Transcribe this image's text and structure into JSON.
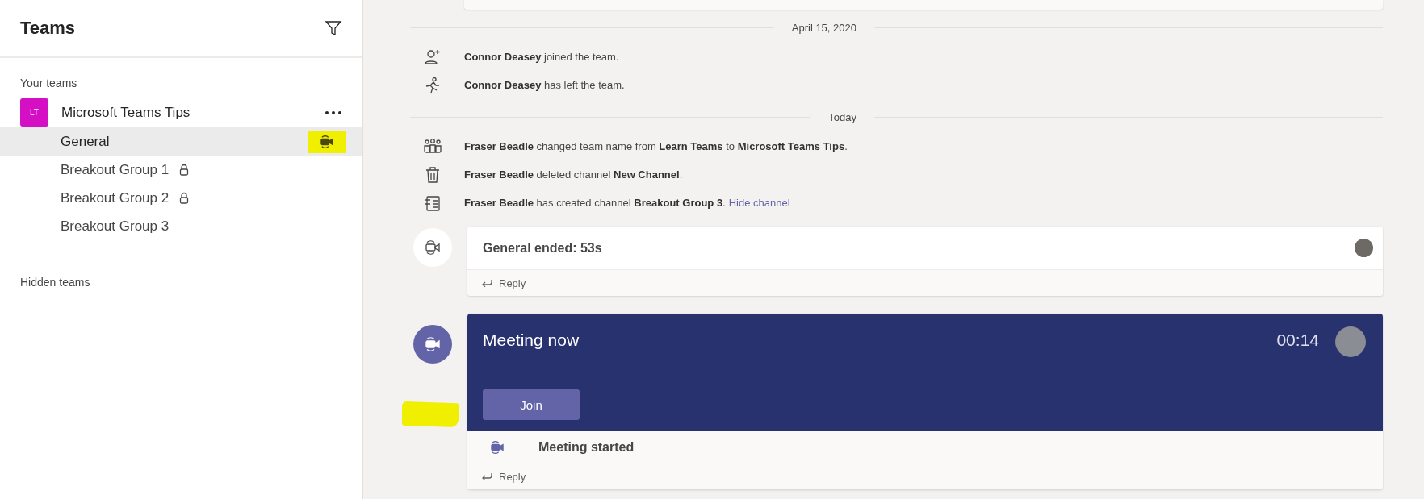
{
  "sidebar": {
    "title": "Teams",
    "your_teams_label": "Your teams",
    "teams": [
      {
        "initials": "LT",
        "name": "Microsoft Teams Tips",
        "color": "#d40fc4",
        "channels": [
          {
            "name": "General",
            "selected": true,
            "locked": false,
            "meeting_active": true
          },
          {
            "name": "Breakout Group 1",
            "selected": false,
            "locked": true,
            "meeting_active": false
          },
          {
            "name": "Breakout Group 2",
            "selected": false,
            "locked": true,
            "meeting_active": false
          },
          {
            "name": "Breakout Group 3",
            "selected": false,
            "locked": false,
            "meeting_active": false
          }
        ]
      }
    ],
    "hidden_teams_label": "Hidden teams"
  },
  "feed": [
    {
      "kind": "date_divider",
      "label": "April 15, 2020"
    },
    {
      "kind": "member_joined",
      "text": "**Connor Deasey** joined the team."
    },
    {
      "kind": "member_left",
      "text": "**Connor Deasey** has left the team."
    },
    {
      "kind": "date_divider",
      "label": "Today"
    },
    {
      "kind": "team_renamed",
      "text": "**Fraser Beadle** changed team name from **Learn Teams** to **Microsoft Teams Tips**."
    },
    {
      "kind": "channel_deleted",
      "text": "**Fraser Beadle** deleted channel **New Channel**."
    },
    {
      "kind": "channel_created",
      "text": "**Fraser Beadle** has created channel **Breakout Group 3**.",
      "link": "Hide channel"
    },
    {
      "kind": "meeting_ended",
      "title": "General ended: 53s",
      "reply": "Reply"
    },
    {
      "kind": "meeting_now",
      "title": "Meeting now",
      "timer": "00:14",
      "button": "Join",
      "note": "Meeting started",
      "reply": "Reply"
    }
  ]
}
